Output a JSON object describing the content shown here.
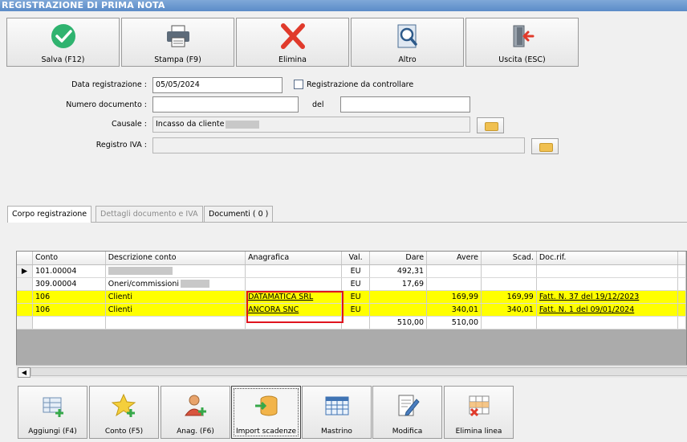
{
  "window": {
    "title": "REGISTRAZIONE DI PRIMA NOTA"
  },
  "toolbar": [
    {
      "label": "Salva (F12)",
      "icon": "check-icon"
    },
    {
      "label": "Stampa (F9)",
      "icon": "printer-icon"
    },
    {
      "label": "Elimina",
      "icon": "delete-x-icon"
    },
    {
      "label": "Altro",
      "icon": "magnifier-icon"
    },
    {
      "label": "Uscita (ESC)",
      "icon": "exit-door-icon"
    }
  ],
  "form": {
    "data_registrazione_label": "Data registrazione :",
    "data_registrazione_value": "05/05/2024",
    "da_controllare_label": "Registrazione da controllare",
    "da_controllare_checked": false,
    "numero_documento_label": "Numero documento :",
    "numero_documento_value": "",
    "del_label": "del",
    "del_value": "",
    "causale_label": "Causale :",
    "causale_value": "Incasso da cliente",
    "registro_iva_label": "Registro IVA :",
    "registro_iva_value": ""
  },
  "tabs": [
    {
      "label": "Corpo registrazione",
      "state": "active"
    },
    {
      "label": "Dettagli documento e IVA",
      "state": "disabled"
    },
    {
      "label": "Documenti ( 0 )",
      "state": "normal"
    }
  ],
  "grid": {
    "columns": [
      "Conto",
      "Descrizione conto",
      "Anagrafica",
      "Val.",
      "Dare",
      "Avere",
      "Scad.",
      "Doc.rif."
    ],
    "rows": [
      {
        "conto": "101.00004",
        "descrizione": "",
        "anagrafica": "",
        "val": "EU",
        "dare": "492,31",
        "avere": "",
        "scad": "",
        "docrif": "",
        "current": true,
        "highlight": false
      },
      {
        "conto": "309.00004",
        "descrizione": "Oneri/commissioni",
        "anagrafica": "",
        "val": "EU",
        "dare": "17,69",
        "avere": "",
        "scad": "",
        "docrif": "",
        "current": false,
        "highlight": false
      },
      {
        "conto": "106",
        "descrizione": "Clienti",
        "anagrafica": "DATAMATICA SRL",
        "val": "EU",
        "dare": "",
        "avere": "169,99",
        "scad": "169,99",
        "docrif": "Fatt. N. 37 del 19/12/2023",
        "current": false,
        "highlight": true
      },
      {
        "conto": "106",
        "descrizione": "Clienti",
        "anagrafica": "ANCORA SNC",
        "val": "EU",
        "dare": "",
        "avere": "340,01",
        "scad": "340,01",
        "docrif": "Fatt. N. 1 del 09/01/2024",
        "current": false,
        "highlight": true
      }
    ],
    "totals": {
      "dare": "510,00",
      "avere": "510,00"
    }
  },
  "bottom_buttons": [
    {
      "label": "Aggiungi (F4)",
      "icon": "add-row-icon"
    },
    {
      "label": "Conto (F5)",
      "icon": "star-add-icon"
    },
    {
      "label": "Anag. (F6)",
      "icon": "user-add-icon"
    },
    {
      "label": "Import scadenze",
      "icon": "import-db-icon"
    },
    {
      "label": "Mastrino",
      "icon": "ledger-grid-icon"
    },
    {
      "label": "Modifica",
      "icon": "edit-document-icon"
    },
    {
      "label": "Elimina linea",
      "icon": "delete-row-icon"
    }
  ],
  "colors": {
    "highlight": "#ffff00",
    "annotation_box": "#e0141e",
    "title_bar": "#6b98d0"
  }
}
